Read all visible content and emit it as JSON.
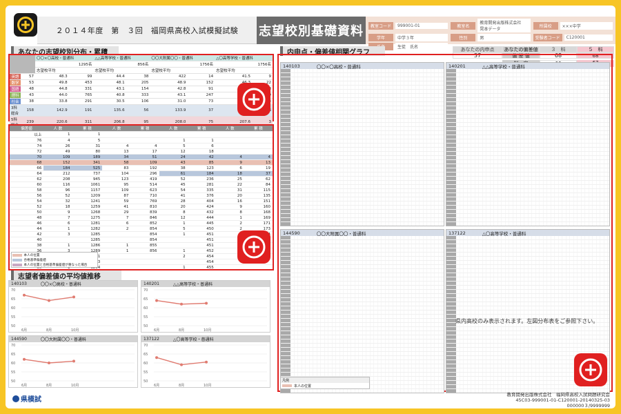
{
  "header": {
    "exam_title": "２０１４年度　第　３回　福岡県高校入試模擬試験",
    "doc_title": "志望校別基礎資料",
    "info": [
      {
        "label": "教室コード",
        "value": "999001-01"
      },
      {
        "label": "教室名",
        "value": "教育開発出版株式会社　晃本データ"
      },
      {
        "label": "所属校",
        "value": "×××中学"
      },
      {
        "label": "学年",
        "value": "中学３年"
      },
      {
        "label": "性別",
        "value": "男"
      },
      {
        "label": "受験者コード",
        "value": "C120001"
      },
      {
        "label": "氏名",
        "value": "生徒　氏名"
      }
    ]
  },
  "score_strip": {
    "header_naishin": "あなたの内申点",
    "header_dev": "あなたの偏差値",
    "col1": "３　科",
    "col2": "５　科",
    "naishin_value": "37",
    "row_labels": [
      "偏 差 値",
      "判　定"
    ],
    "dev_3": "68",
    "dev_5": "68",
    "judge_3": "66",
    "judge_5": "67"
  },
  "sections": {
    "dist": "あなたの志望校別分布・累積",
    "avg": "志望者偏差値の平均値推移",
    "corr": "内申点・偏差値相関グラフ"
  },
  "dist_table": {
    "schools": [
      "〇〇×〇高校・普通科",
      "△△高等学校・普通科",
      "〇〇大附属〇〇・普通科",
      "△〇高等学校・普通科"
    ],
    "totals": [
      "1295名",
      "856名",
      "1756名",
      "1756名"
    ],
    "col_headers": [
      "志望校平均",
      "志望校平均",
      "志望校平均",
      "志望校平均"
    ],
    "subjects": [
      {
        "label": "英語",
        "color": "#d76a5e",
        "vals": [
          "57",
          "48.3",
          "99",
          "44.4",
          "38",
          "422",
          "14",
          "41.5",
          "9"
        ]
      },
      {
        "label": "数学",
        "color": "#e5916b",
        "vals": [
          "53",
          "49.8",
          "453",
          "48.1",
          "205",
          "48.9",
          "152",
          "46.3",
          "22"
        ]
      },
      {
        "label": "国語",
        "color": "#d45d8e",
        "vals": [
          "48",
          "44.8",
          "331",
          "43.1",
          "154",
          "42.8",
          "91",
          "45.1",
          "18"
        ]
      },
      {
        "label": "理科",
        "color": "#8fb45a",
        "vals": [
          "43",
          "44.0",
          "765",
          "40.8",
          "333",
          "43.1",
          "247",
          "39.5",
          "29"
        ]
      },
      {
        "label": "社会",
        "color": "#6a8fcf",
        "vals": [
          "38",
          "33.8",
          "291",
          "30.5",
          "106",
          "31.0",
          "73",
          "32.2",
          "4"
        ]
      }
    ],
    "sum_rows": [
      {
        "label": "3科総合",
        "vals": [
          "158",
          "142.9",
          "191",
          "135.6",
          "56",
          "133.9",
          "37",
          "134.4",
          "6"
        ]
      },
      {
        "label": "5科総合",
        "vals": [
          "239",
          "220.6",
          "311",
          "206.8",
          "95",
          "208.0",
          "75",
          "207.6",
          "3"
        ]
      }
    ]
  },
  "cum_table": {
    "headers": [
      "偏差値",
      "人 数",
      "累 積",
      "人 数",
      "累 積",
      "人 数",
      "累 積",
      "人 数",
      "累 積"
    ],
    "rows": [
      [
        "以上",
        "1",
        "1",
        "",
        "",
        "",
        "",
        "",
        ""
      ],
      [
        "76",
        "4",
        "5",
        "",
        "",
        "1",
        "1",
        "",
        ""
      ],
      [
        "74",
        "26",
        "31",
        "4",
        "4",
        "5",
        "6",
        "",
        ""
      ],
      [
        "72",
        "49",
        "80",
        "13",
        "17",
        "12",
        "18",
        "",
        ""
      ],
      [
        "70",
        "109",
        "189",
        "34",
        "51",
        "24",
        "42",
        "4",
        "4"
      ],
      [
        "68",
        "152",
        "341",
        "58",
        "109",
        "43",
        "85",
        "9",
        "13"
      ],
      [
        "66",
        "184",
        "525",
        "83",
        "192",
        "38",
        "123",
        "6",
        "19"
      ],
      [
        "64",
        "212",
        "737",
        "104",
        "296",
        "61",
        "184",
        "18",
        "37"
      ],
      [
        "62",
        "208",
        "945",
        "123",
        "419",
        "52",
        "236",
        "25",
        "62"
      ],
      [
        "60",
        "116",
        "1061",
        "95",
        "514",
        "45",
        "281",
        "22",
        "84"
      ],
      [
        "58",
        "96",
        "1157",
        "109",
        "623",
        "54",
        "335",
        "31",
        "115"
      ],
      [
        "56",
        "52",
        "1209",
        "87",
        "710",
        "41",
        "376",
        "20",
        "135"
      ],
      [
        "54",
        "32",
        "1241",
        "59",
        "769",
        "28",
        "404",
        "16",
        "151"
      ],
      [
        "52",
        "18",
        "1259",
        "41",
        "810",
        "20",
        "424",
        "9",
        "160"
      ],
      [
        "50",
        "9",
        "1268",
        "29",
        "839",
        "8",
        "432",
        "8",
        "168"
      ],
      [
        "48",
        "7",
        "1275",
        "7",
        "846",
        "12",
        "444",
        "1",
        "169"
      ],
      [
        "46",
        "6",
        "1281",
        "6",
        "852",
        "1",
        "445",
        "2",
        "171"
      ],
      [
        "44",
        "1",
        "1282",
        "2",
        "854",
        "5",
        "450",
        "2",
        "173"
      ],
      [
        "42",
        "3",
        "1285",
        "",
        "854",
        "1",
        "451",
        "1",
        "174"
      ],
      [
        "40",
        "",
        "1285",
        "",
        "854",
        "",
        "451",
        "",
        "174"
      ],
      [
        "38",
        "1",
        "1286",
        "1",
        "855",
        "",
        "451",
        "",
        "174"
      ],
      [
        "36",
        "3",
        "1289",
        "1",
        "856",
        "1",
        "452",
        "",
        "174"
      ],
      [
        "34",
        "2",
        "1291",
        "",
        "",
        "2",
        "454",
        "",
        ""
      ],
      [
        "32",
        "2",
        "1293",
        "",
        "",
        "",
        "454",
        "",
        ""
      ],
      [
        "30",
        "1",
        "1294",
        "",
        "",
        "1",
        "455",
        "",
        ""
      ],
      [
        "以下",
        "1",
        "1295",
        "",
        "",
        "1",
        "456",
        "",
        ""
      ]
    ],
    "legend": [
      "本人の位置",
      "合格基準偏差値",
      "本人の位置と合格基準偏差値が重なった場合"
    ]
  },
  "avg_charts": [
    {
      "code": "140103",
      "name": "〇〇×〇高校・普通科",
      "values": [
        67,
        64,
        66
      ],
      "xlabels": [
        "6月",
        "8月",
        "10月"
      ],
      "yticks": [
        "70",
        "65",
        "60",
        "55",
        "50"
      ]
    },
    {
      "code": "140201",
      "name": "△△高等学校・普通科",
      "values": [
        64,
        62,
        62.5
      ],
      "xlabels": [
        "6月",
        "8月",
        "10月"
      ],
      "yticks": [
        "70",
        "65",
        "60",
        "55",
        "50"
      ]
    },
    {
      "code": "144590",
      "name": "〇〇大附属〇〇・普通科",
      "values": [
        62,
        60,
        61
      ],
      "xlabels": [
        "6月",
        "8月",
        "10月"
      ],
      "yticks": [
        "70",
        "65",
        "60",
        "55",
        "50"
      ]
    },
    {
      "code": "137122",
      "name": "△〇高等学校・普通科",
      "values": [
        63,
        59,
        60.5
      ],
      "xlabels": [
        "6月",
        "8月",
        "10月"
      ],
      "yticks": [
        "70",
        "65",
        "60",
        "55",
        "50"
      ]
    }
  ],
  "corr_panels": [
    {
      "code": "140103",
      "name": "〇〇×〇高校・普通科"
    },
    {
      "code": "140201",
      "name": "△△高等学校・普通科"
    },
    {
      "code": "144590",
      "name": "〇〇大附属〇〇・普通科"
    },
    {
      "code": "137122",
      "name": "△〇高等学校・普通科"
    }
  ],
  "corr_note": "県内高校のみ表示されます。左図分布表をご参照下さい。",
  "corr_legend": [
    "凡例",
    "本人の位置"
  ],
  "footer": {
    "logo": "県模試",
    "publisher": "教育開発出版株式会社　福岡県高校入試問題研究会",
    "code1": "45C03-999001-01-C120001-20140325-03",
    "code2": "000000３/9999999"
  },
  "colors": {
    "frame": "#e02020",
    "background": "#f7c525",
    "school_header": "#cbe7e4",
    "highlight_blue": "#b8c7dc",
    "highlight_pink": "#e9c0b3",
    "line": "#e07b70"
  }
}
